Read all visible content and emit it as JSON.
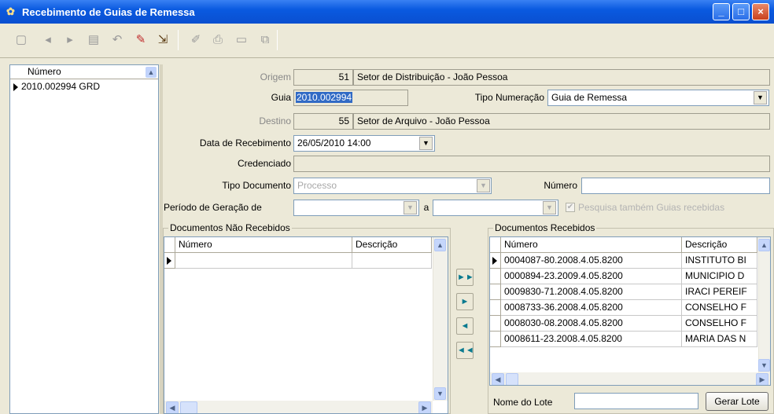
{
  "window": {
    "title": "Recebimento de Guias de Remessa",
    "buttons": {
      "minimize": "_",
      "maximize": "□",
      "close": "×"
    }
  },
  "toolbar": {
    "icons": [
      "form-icon",
      "prev-icon",
      "next-icon",
      "save-icon",
      "undo-icon",
      "clear-icon",
      "exit-icon",
      "edit-icon",
      "print-icon",
      "preview-icon",
      "copy-icon"
    ]
  },
  "left_list": {
    "header": "Número",
    "items": [
      "2010.002994 GRD"
    ]
  },
  "form": {
    "origem_label": "Origem",
    "origem_code": "51",
    "origem_name": "Setor de Distribuição - João Pessoa",
    "guia_label": "Guia",
    "guia_value": "2010.002994",
    "tipo_numeracao_label": "Tipo Numeração",
    "tipo_numeracao_value": "Guia de Remessa",
    "destino_label": "Destino",
    "destino_code": "55",
    "destino_name": "Setor de Arquivo - João Pessoa",
    "data_label": "Data de Recebimento",
    "data_value": "26/05/2010 14:00",
    "credenciado_label": "Credenciado",
    "credenciado_value": "",
    "tipo_doc_label": "Tipo Documento",
    "tipo_doc_value": "Processo",
    "numero_label": "Número",
    "numero_value": "",
    "periodo_label": "Período de Geração de",
    "periodo_a": "a",
    "pesquisa_label": "Pesquisa também Guias recebidas"
  },
  "nao_recebidos": {
    "title": "Documentos Não Recebidos",
    "columns": [
      "Número",
      "Descrição"
    ]
  },
  "recebidos": {
    "title": "Documentos Recebidos",
    "columns": [
      "Número",
      "Descrição"
    ],
    "rows": [
      {
        "numero": "0004087-80.2008.4.05.8200",
        "descricao": "INSTITUTO BI"
      },
      {
        "numero": "0000894-23.2009.4.05.8200",
        "descricao": "MUNICIPIO D"
      },
      {
        "numero": "0009830-71.2008.4.05.8200",
        "descricao": "IRACI PEREIF"
      },
      {
        "numero": "0008733-36.2008.4.05.8200",
        "descricao": "CONSELHO F"
      },
      {
        "numero": "0008030-08.2008.4.05.8200",
        "descricao": "CONSELHO F"
      },
      {
        "numero": "0008611-23.2008.4.05.8200",
        "descricao": "MARIA DAS N"
      }
    ]
  },
  "move_buttons": {
    "all_right": "►►",
    "one_right": "►",
    "one_left": "◄",
    "all_left": "◄◄"
  },
  "lote": {
    "label": "Nome do Lote",
    "value": "",
    "button": "Gerar Lote"
  }
}
